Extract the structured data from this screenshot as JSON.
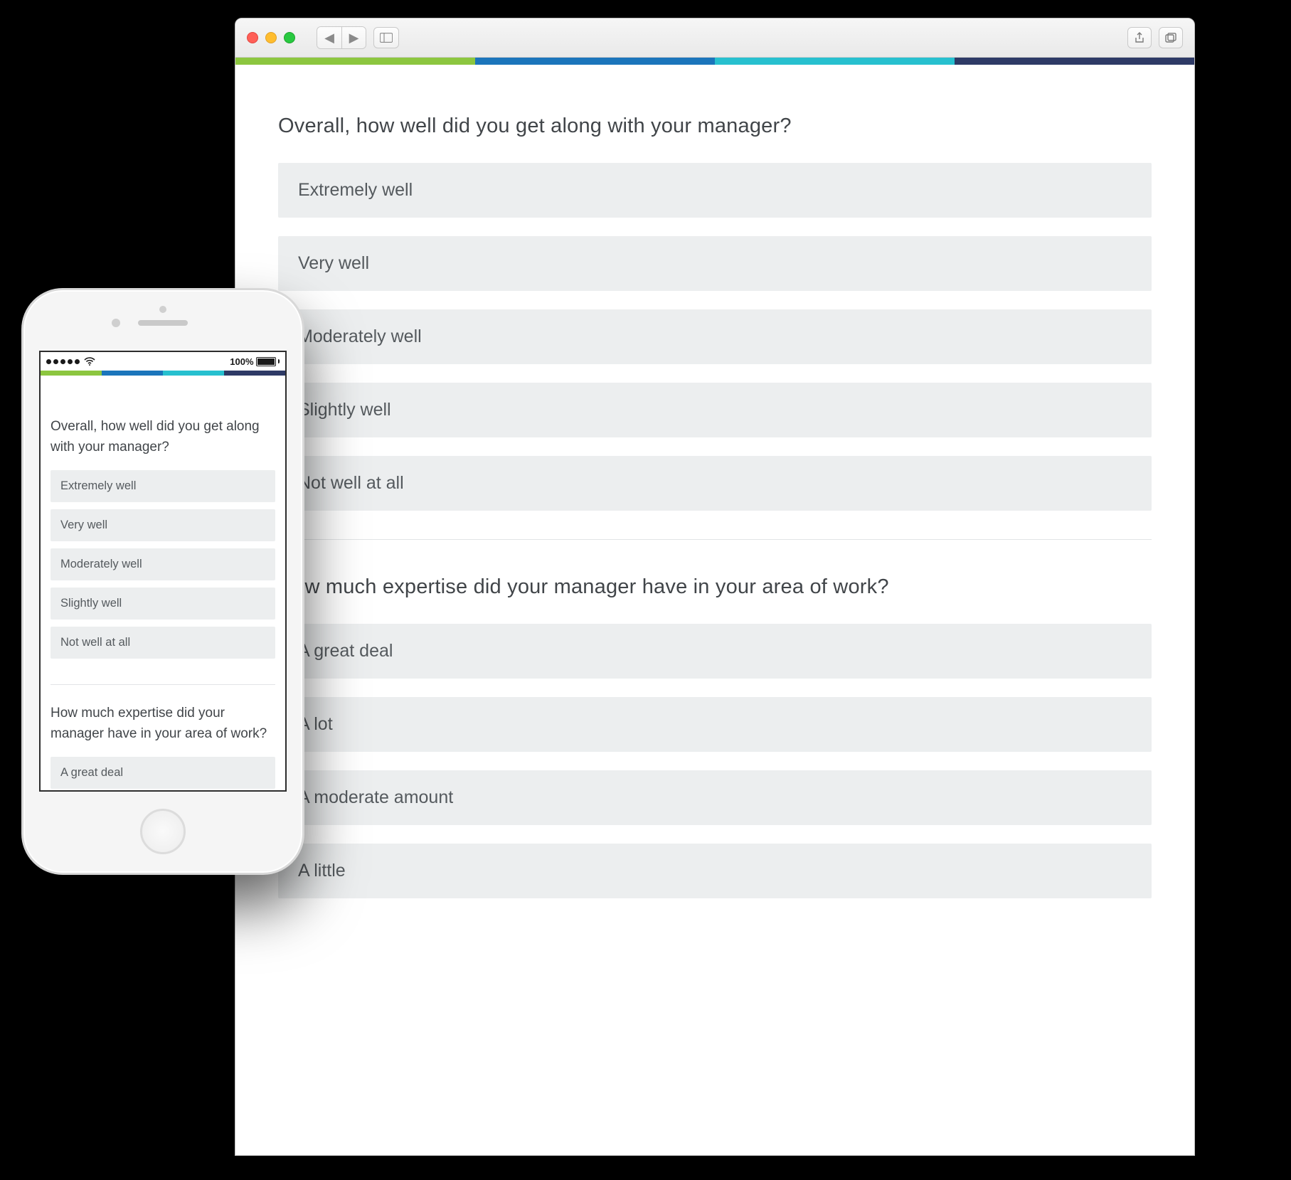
{
  "brand_colors": [
    "#8cc63f",
    "#1b75bb",
    "#27c0cf",
    "#2e3a66"
  ],
  "phone": {
    "status": {
      "battery_text": "100%"
    }
  },
  "survey": {
    "questions": [
      {
        "text": "Overall, how well did you get along with your manager?",
        "answers": [
          "Extremely well",
          "Very well",
          "Moderately well",
          "Slightly well",
          "Not well at all"
        ]
      },
      {
        "text": "How much expertise did your manager have in your area of work?",
        "answers": [
          "A great deal",
          "A lot",
          "A moderate amount",
          "A little"
        ]
      }
    ]
  }
}
